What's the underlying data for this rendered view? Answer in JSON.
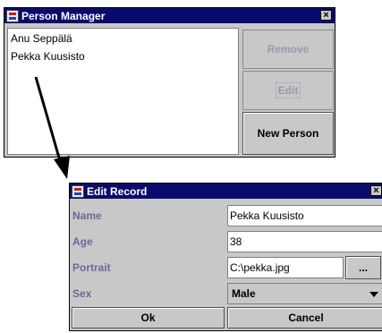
{
  "person_manager": {
    "title": "Person Manager",
    "close": "×",
    "people": [
      "Anu Seppälä",
      "Pekka Kuusisto"
    ],
    "remove_label": "Remove",
    "edit_label": "Edit",
    "new_person_label": "New Person"
  },
  "edit_record": {
    "title": "Edit Record",
    "close": "×",
    "fields": [
      {
        "label": "Name",
        "value": "Pekka Kuusisto"
      },
      {
        "label": "Age",
        "value": "38"
      },
      {
        "label": "Portrait",
        "value": "C:\\pekka.jpg"
      },
      {
        "label": "Sex",
        "value": "Male"
      }
    ],
    "browse_label": "...",
    "ok_label": "Ok",
    "cancel_label": "Cancel"
  },
  "icons": [
    "app-icon",
    "close-icon",
    "arrow-icon",
    "dropdown-arrow-icon"
  ]
}
